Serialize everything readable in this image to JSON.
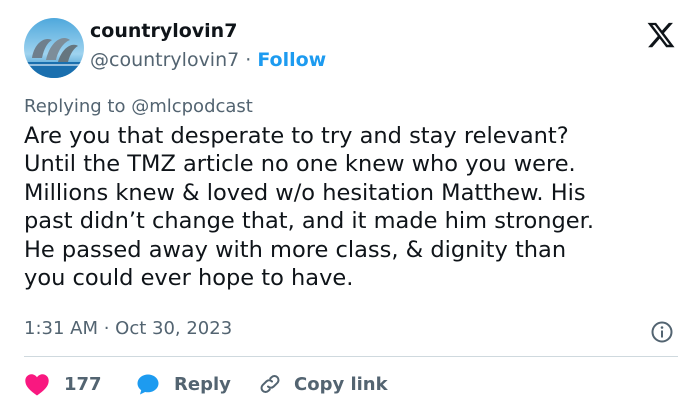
{
  "user": {
    "display_name": "countrylovin7",
    "handle": "@countrylovin7",
    "separator": " · ",
    "follow_label": "Follow",
    "avatar_icon": "dolphins-avatar"
  },
  "brand": {
    "logo_icon": "x-logo-icon"
  },
  "reply_context": {
    "prefix": "Replying to ",
    "mention": "@mlcpodcast"
  },
  "tweet": {
    "text": "Are you that desperate to try and stay relevant?\nUntil the TMZ article no one knew who you were.\nMillions knew & loved w/o hesitation Matthew.  His\npast didn’t change that, and it made him stronger.\nHe passed away with more class, & dignity than\nyou could ever hope to have.",
    "timestamp": "1:31 AM · Oct 30, 2023"
  },
  "actions": {
    "like_count": "177",
    "reply_label": "Reply",
    "copy_label": "Copy link"
  },
  "colors": {
    "accent": "#1d9bf0",
    "like": "#f91880",
    "text_primary": "#0f1419",
    "text_secondary": "#536471",
    "divider": "#cfd9de"
  }
}
